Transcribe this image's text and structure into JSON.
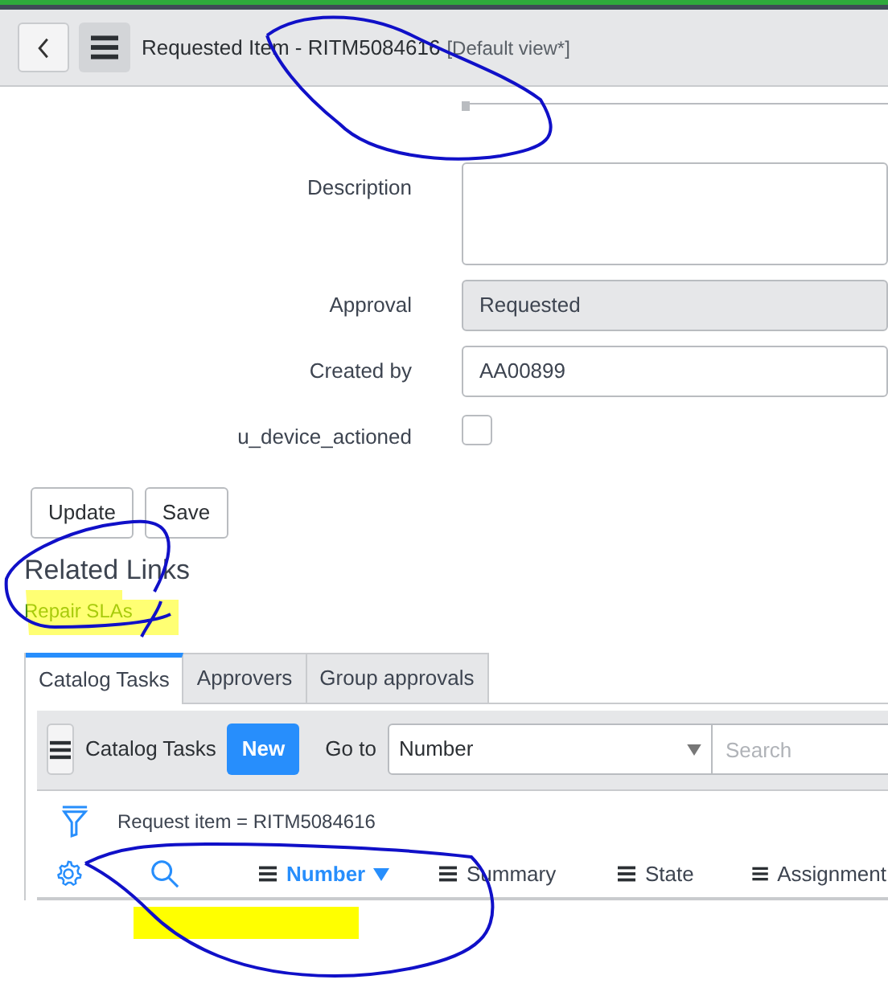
{
  "header": {
    "title": "Requested Item - RITM5084616",
    "view": "[Default view*]"
  },
  "fields": [
    {
      "kind": "textarea",
      "label": "Description"
    },
    {
      "kind": "readonly",
      "label": "Approval",
      "value": "Requested"
    },
    {
      "kind": "text",
      "label": "Created by",
      "value": "AA00899"
    },
    {
      "kind": "checkbox",
      "label": "u_device_actioned",
      "checked": false
    }
  ],
  "buttons": [
    "Update",
    "Save"
  ],
  "related_links": {
    "title": "Related Links",
    "links": [
      "Repair SLAs"
    ]
  },
  "tabs": [
    {
      "label": "Catalog Tasks",
      "selected": true
    },
    {
      "label": "Approvers",
      "selected": false
    },
    {
      "label": "Group approvals",
      "selected": false
    }
  ],
  "list": {
    "title": "Catalog Tasks",
    "new_button": "New",
    "goto_label": "Go to",
    "goto_field": "Number",
    "search": {
      "placeholder": "Search"
    },
    "filter": "Request item = RITM5084616",
    "columns": [
      {
        "label": "Number",
        "sorted": true
      },
      {
        "label": "Summary",
        "sorted": false
      },
      {
        "label": "State",
        "sorted": false
      },
      {
        "label": "Assignment",
        "sorted": false
      }
    ]
  }
}
